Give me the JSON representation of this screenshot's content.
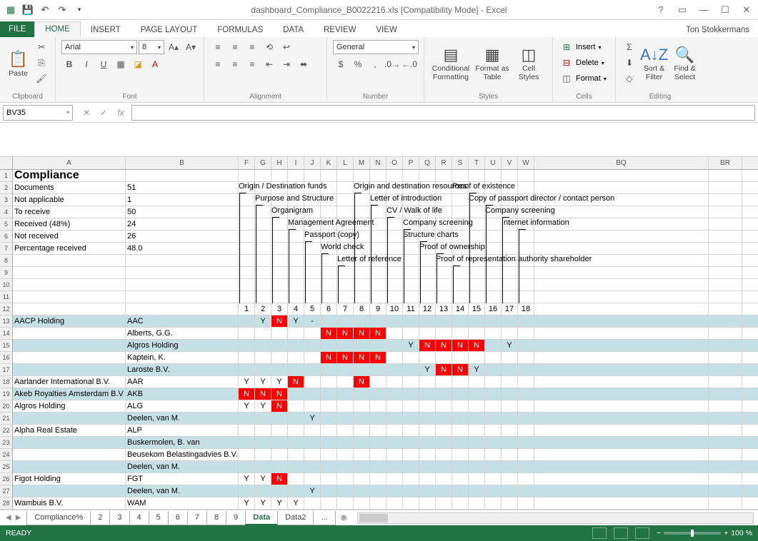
{
  "title": "dashboard_Compliance_B0022216.xls  [Compatibility Mode] - Excel",
  "account": "Ton  Stokkermans",
  "ribbon_tabs": [
    "FILE",
    "HOME",
    "INSERT",
    "PAGE LAYOUT",
    "FORMULAS",
    "DATA",
    "REVIEW",
    "VIEW"
  ],
  "groups": {
    "clipboard": "Clipboard",
    "font": "Font",
    "alignment": "Alignment",
    "number": "Number",
    "styles": "Styles",
    "cells": "Cells",
    "editing": "Editing",
    "paste": "Paste",
    "font_name": "Arial",
    "font_size": "8",
    "number_format": "General",
    "cond_fmt": "Conditional Formatting",
    "fmt_table": "Format as Table",
    "cell_styles": "Cell Styles",
    "insert": "Insert",
    "delete": "Delete",
    "format": "Format",
    "sort_filter": "Sort & Filter",
    "find_select": "Find & Select"
  },
  "namebox": "BV35",
  "col_headers": [
    "A",
    "B",
    "F",
    "G",
    "H",
    "I",
    "J",
    "K",
    "L",
    "M",
    "N",
    "O",
    "P",
    "Q",
    "R",
    "S",
    "T",
    "U",
    "V",
    "W",
    "BQ",
    "BR"
  ],
  "row_numbers": [
    1,
    2,
    3,
    4,
    5,
    6,
    7,
    8,
    9,
    10,
    11,
    12,
    13,
    14,
    15,
    16,
    17,
    18,
    19,
    20,
    21,
    22,
    23,
    24,
    25,
    26,
    27,
    28
  ],
  "summary": {
    "title": "Compliance",
    "rows": [
      [
        "Documents",
        "51"
      ],
      [
        "Not applicable",
        "1"
      ],
      [
        "To receive",
        "50"
      ],
      [
        "Received (48%)",
        "24"
      ],
      [
        "Not received",
        "26"
      ],
      [
        "Percentage received",
        "48.0"
      ]
    ]
  },
  "diag_headers": {
    "r1": [
      "Origin / Destination funds",
      "Origin and destination resources",
      "Proof of existence"
    ],
    "r2": [
      "Purpose and Structure",
      "Letter of introduction",
      "Copy of passport director / contact person"
    ],
    "r3": [
      "Organigram",
      "CV / Walk of life",
      "Company screening"
    ],
    "r4": [
      "Management Agreement",
      "Company screening",
      "Internet information"
    ],
    "r5": [
      "Passport (copy)",
      "Structure charts"
    ],
    "r6": [
      "World check",
      "Proof of ownership"
    ],
    "r7": [
      "Letter of reference",
      "Proof of representation authority shareholder"
    ]
  },
  "column_numbers": [
    1,
    2,
    3,
    4,
    5,
    6,
    7,
    8,
    9,
    10,
    11,
    12,
    13,
    14,
    15,
    16,
    17,
    18
  ],
  "data_rows": [
    {
      "r": 13,
      "band": true,
      "a": "AACP Holding",
      "b": "AAC",
      "cells": {
        "2": "Y",
        "3": "N!",
        "4": "Y",
        "5": "-"
      }
    },
    {
      "r": 14,
      "a": "",
      "b": "Alberts, G.G.",
      "cells": {
        "6": "N!",
        "7": "N!",
        "8": "N!",
        "9": "N!"
      }
    },
    {
      "r": 15,
      "band": true,
      "a": "",
      "b": "Algros Holding",
      "cells": {
        "11": "Y",
        "12": "N!",
        "13": "N!",
        "14": "N!",
        "15": "N!",
        "17": "Y"
      }
    },
    {
      "r": 16,
      "a": "",
      "b": "Kaptein, K.",
      "cells": {
        "6": "N!",
        "7": "N!",
        "8": "N!",
        "9": "N!"
      }
    },
    {
      "r": 17,
      "band": true,
      "a": "",
      "b": "Laroste B.V.",
      "cells": {
        "12": "Y",
        "13": "N!",
        "14": "N!",
        "15": "Y"
      }
    },
    {
      "r": 18,
      "a": "Aarlander International B.V.",
      "b": "AAR",
      "cells": {
        "1": "Y",
        "2": "Y",
        "3": "Y",
        "4": "N!",
        "8": "N!"
      }
    },
    {
      "r": 19,
      "band": true,
      "a": "Akeb Royalties Amsterdam B.V",
      "b": "AKB",
      "cells": {
        "1": "N!",
        "2": "N!",
        "3": "N!"
      }
    },
    {
      "r": 20,
      "a": "Algros Holding",
      "b": "ALG",
      "cells": {
        "1": "Y",
        "2": "Y",
        "3": "N!"
      }
    },
    {
      "r": 21,
      "band": true,
      "a": "",
      "b": "Deelen, van M.",
      "cells": {
        "5": "Y"
      }
    },
    {
      "r": 22,
      "a": "Alpha Real Estate",
      "b": "ALP",
      "cells": {}
    },
    {
      "r": 23,
      "band": true,
      "a": "",
      "b": "Buskermolen, B. van",
      "cells": {}
    },
    {
      "r": 24,
      "a": "",
      "b": "Beusekom Belastingadvies B.V.",
      "cells": {}
    },
    {
      "r": 25,
      "band": true,
      "a": "",
      "b": "Deelen, van M.",
      "cells": {}
    },
    {
      "r": 26,
      "a": "Figot Holding",
      "b": "FGT",
      "cells": {
        "1": "Y",
        "2": "Y",
        "3": "N!"
      }
    },
    {
      "r": 27,
      "band": true,
      "a": "",
      "b": "Deelen, van M.",
      "cells": {
        "5": "Y"
      }
    },
    {
      "r": 28,
      "a": "Wambuis B.V.",
      "b": "WAM",
      "cells": {
        "1": "Y",
        "2": "Y",
        "3": "Y",
        "4": "Y"
      }
    }
  ],
  "sheets": [
    "Compliance%",
    "2",
    "3",
    "4",
    "5",
    "6",
    "7",
    "8",
    "9",
    "Data",
    "Data2",
    "..."
  ],
  "active_sheet": "Data",
  "status": "READY",
  "zoom": "100 %"
}
